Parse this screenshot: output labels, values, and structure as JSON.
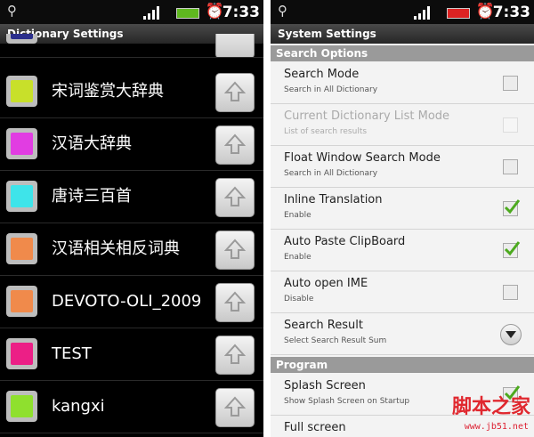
{
  "left_screen": {
    "status": {
      "time": "7:33"
    },
    "title": "Dictionary Settings",
    "items": [
      {
        "name": "宋词鉴赏大辞典",
        "color": "#c8e02a"
      },
      {
        "name": "汉语大辞典",
        "color": "#e13de2"
      },
      {
        "name": "唐诗三百首",
        "color": "#3ee4ea"
      },
      {
        "name": "汉语相关相反词典",
        "color": "#f08a4b"
      },
      {
        "name": "DEVOTO-OLI_2009",
        "color": "#f08a4b"
      },
      {
        "name": "TEST",
        "color": "#ec1f86"
      },
      {
        "name": "kangxi",
        "color": "#8fe02e"
      }
    ]
  },
  "right_screen": {
    "status": {
      "time": "7:33"
    },
    "title": "System Settings",
    "sections": {
      "search_options": "Search Options",
      "program": "Program"
    },
    "prefs": [
      {
        "title": "Search Mode",
        "summary": "Search in All Dictionary",
        "checked": false,
        "enabled": true
      },
      {
        "title": "Current Dictionary List Mode",
        "summary": "List of search results",
        "checked": false,
        "enabled": false
      },
      {
        "title": "Float Window Search Mode",
        "summary": "Search in All Dictionary",
        "checked": false,
        "enabled": true
      },
      {
        "title": "Inline Translation",
        "summary": "Enable",
        "checked": true,
        "enabled": true
      },
      {
        "title": "Auto Paste ClipBoard",
        "summary": "Enable",
        "checked": true,
        "enabled": true
      },
      {
        "title": "Auto open IME",
        "summary": "Disable",
        "checked": false,
        "enabled": true
      },
      {
        "title": "Search Result",
        "summary": "Select Search Result Sum",
        "type": "dropdown"
      }
    ],
    "program_prefs": [
      {
        "title": "Splash Screen",
        "summary": "Show Splash Screen on Startup",
        "checked": true
      },
      {
        "title": "Full screen",
        "summary": ""
      }
    ]
  },
  "watermark": {
    "text": "脚本之家",
    "url": "www.jb51.net"
  },
  "icons": {
    "usb": "usb-icon",
    "signal": "signal-icon",
    "battery": "battery-icon",
    "alarm": "alarm-icon",
    "up": "arrow-up-icon",
    "check": "check-icon",
    "chevron": "chevron-down-icon"
  }
}
